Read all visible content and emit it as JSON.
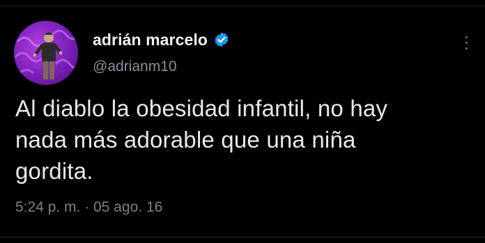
{
  "tweet": {
    "display_name": "adrián marcelo",
    "handle": "@adrianm10",
    "text": "Al diablo la obesidad infantil, no hay\nnada más adorable que una niña\ngordita.",
    "timestamp": "5:24 p. m. · 05 ago. 16",
    "verified_icon": "verified-badge-icon",
    "more_icon": "more-options-icon"
  },
  "colors": {
    "background": "#000000",
    "text_primary": "#e7e9ea",
    "text_secondary": "#8a9097",
    "verified_blue": "#1d9bf0",
    "avatar_purple": "#8a2be2"
  }
}
